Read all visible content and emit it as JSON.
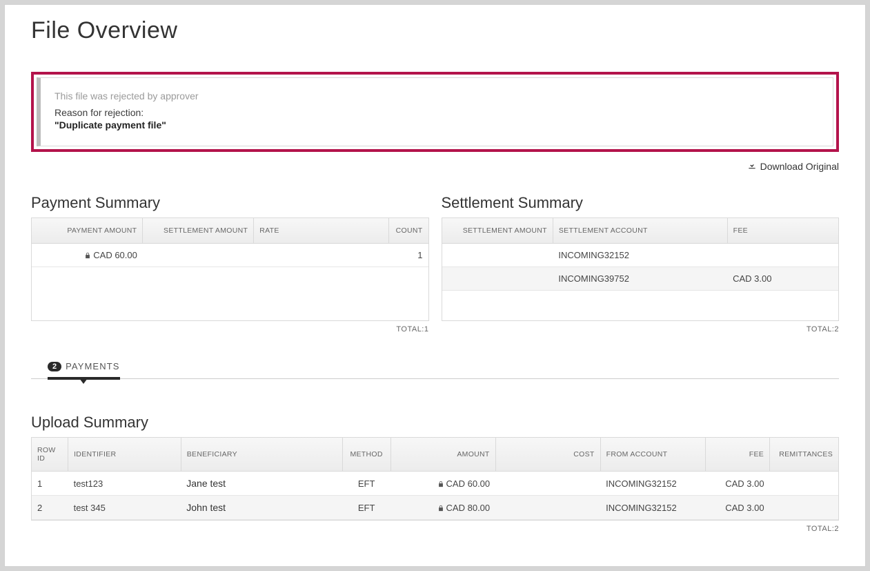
{
  "page": {
    "title": "File Overview"
  },
  "rejection": {
    "status": "This file was rejected by approver",
    "reason_label": "Reason for rejection:",
    "reason": "\"Duplicate payment file\""
  },
  "download": {
    "label": "Download Original"
  },
  "payment_summary": {
    "title": "Payment Summary",
    "headers": {
      "payment_amount": "PAYMENT AMOUNT",
      "settlement_amount": "SETTLEMENT AMOUNT",
      "rate": "RATE",
      "count": "COUNT"
    },
    "rows": [
      {
        "payment_amount": "CAD 60.00",
        "locked": true,
        "settlement_amount": "",
        "rate": "",
        "count": "1"
      }
    ],
    "total_label": "TOTAL:",
    "total_value": "1"
  },
  "settlement_summary": {
    "title": "Settlement Summary",
    "headers": {
      "settlement_amount": "SETTLEMENT AMOUNT",
      "settlement_account": "SETTLEMENT ACCOUNT",
      "fee": "FEE"
    },
    "rows": [
      {
        "settlement_amount": "",
        "settlement_account": "INCOMING32152",
        "fee": ""
      },
      {
        "settlement_amount": "",
        "settlement_account": "INCOMING39752",
        "fee": "CAD 3.00"
      }
    ],
    "total_label": "TOTAL:",
    "total_value": "2"
  },
  "tabs": {
    "payments": {
      "count": "2",
      "label": "PAYMENTS"
    }
  },
  "upload_summary": {
    "title": "Upload Summary",
    "headers": {
      "row_id": "ROW ID",
      "identifier": "IDENTIFIER",
      "beneficiary": "BENEFICIARY",
      "method": "METHOD",
      "amount": "AMOUNT",
      "cost": "COST",
      "from_account": "FROM ACCOUNT",
      "fee": "FEE",
      "remittances": "REMITTANCES"
    },
    "rows": [
      {
        "row_id": "1",
        "identifier": "test123",
        "beneficiary": "Jane test",
        "method": "EFT",
        "amount": "CAD 60.00",
        "locked": true,
        "cost": "",
        "from_account": "INCOMING32152",
        "fee": "CAD 3.00",
        "remittances": ""
      },
      {
        "row_id": "2",
        "identifier": "test 345",
        "beneficiary": "John test",
        "method": "EFT",
        "amount": "CAD 80.00",
        "locked": true,
        "cost": "",
        "from_account": "INCOMING32152",
        "fee": "CAD 3.00",
        "remittances": ""
      }
    ],
    "total_label": "TOTAL:",
    "total_value": "2"
  }
}
